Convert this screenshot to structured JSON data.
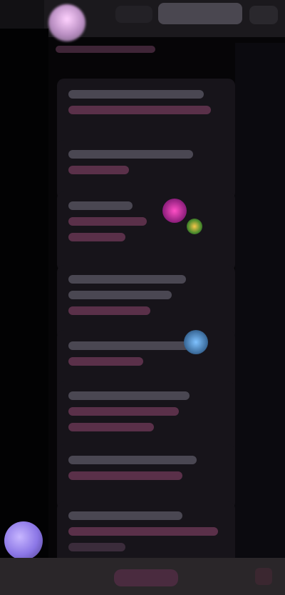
{
  "topbar": {
    "title": ""
  },
  "feed": {
    "header": "",
    "cards": [
      {
        "lines": [
          "",
          ""
        ]
      },
      {
        "lines": [
          "",
          ""
        ]
      },
      {
        "lines": [
          "",
          "",
          ""
        ]
      },
      {
        "lines": [
          "",
          "",
          ""
        ]
      },
      {
        "lines": [
          "",
          ""
        ]
      },
      {
        "lines": [
          "",
          "",
          ""
        ]
      },
      {
        "lines": [
          "",
          ""
        ]
      },
      {
        "lines": [
          "",
          "",
          ""
        ]
      }
    ]
  },
  "bottombar": {
    "primary_label": ""
  },
  "icons": {
    "fab": "avatar-icon",
    "top_avatar": "avatar-icon",
    "bottom_right": "menu-icon"
  }
}
